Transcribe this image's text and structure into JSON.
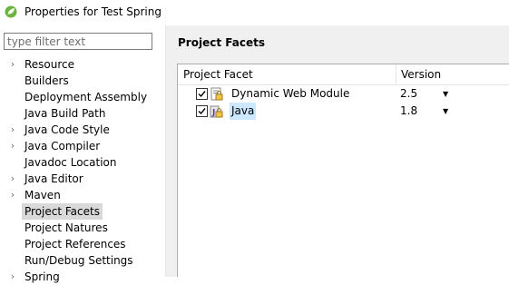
{
  "window": {
    "title": "Properties for Test Spring"
  },
  "sidebar": {
    "filter_placeholder": "type filter text",
    "items": [
      {
        "label": "Resource",
        "expandable": true,
        "selected": false
      },
      {
        "label": "Builders",
        "expandable": false,
        "selected": false
      },
      {
        "label": "Deployment Assembly",
        "expandable": false,
        "selected": false
      },
      {
        "label": "Java Build Path",
        "expandable": false,
        "selected": false
      },
      {
        "label": "Java Code Style",
        "expandable": true,
        "selected": false
      },
      {
        "label": "Java Compiler",
        "expandable": true,
        "selected": false
      },
      {
        "label": "Javadoc Location",
        "expandable": false,
        "selected": false
      },
      {
        "label": "Java Editor",
        "expandable": true,
        "selected": false
      },
      {
        "label": "Maven",
        "expandable": true,
        "selected": false
      },
      {
        "label": "Project Facets",
        "expandable": false,
        "selected": true
      },
      {
        "label": "Project Natures",
        "expandable": false,
        "selected": false
      },
      {
        "label": "Project References",
        "expandable": false,
        "selected": false
      },
      {
        "label": "Run/Debug Settings",
        "expandable": false,
        "selected": false
      },
      {
        "label": "Spring",
        "expandable": true,
        "selected": false
      }
    ]
  },
  "main": {
    "title": "Project Facets",
    "table": {
      "columns": [
        "Project Facet",
        "Version"
      ],
      "rows": [
        {
          "facet": "Dynamic Web Module",
          "version": "2.5",
          "checked": true,
          "selected": false,
          "icon": "web-module-icon"
        },
        {
          "facet": "Java",
          "version": "1.8",
          "checked": true,
          "selected": true,
          "icon": "java-facet-icon"
        }
      ]
    }
  },
  "colors": {
    "selection": "#cce8ff",
    "tree_selection": "#d9d9d9",
    "panel_bg": "#f0f0f0"
  }
}
